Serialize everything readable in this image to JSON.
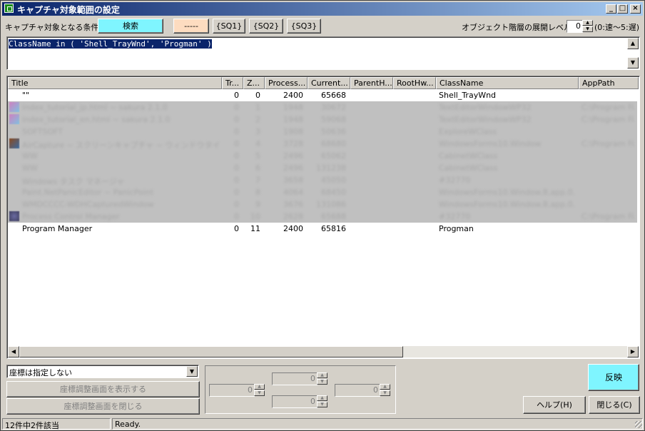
{
  "window": {
    "title": "キャプチャ対象範囲の設定",
    "controls": [
      "_",
      "□",
      "×"
    ]
  },
  "toolbar": {
    "condition_label": "キャプチャ対象となる条件:",
    "search_button": "検索",
    "dash_button": "-----",
    "sq1": "{SQ1}",
    "sq2": "{SQ2}",
    "sq3": "{SQ3}",
    "level_label": "オブジェクト階層の展開レベル:",
    "level_value": "0",
    "level_hint": "(0:速～5:遅)"
  },
  "query": {
    "text": "ClassName in ( 'Shell_TrayWnd', 'Progman' )"
  },
  "table": {
    "columns": [
      "Title",
      "Tr...",
      "Z...",
      "Process...",
      "Current...",
      "ParentH...",
      "RootHw...",
      "ClassName",
      "AppPath"
    ],
    "rows": [
      {
        "title": "\"\"",
        "tr": "0",
        "z": "0",
        "process": "2400",
        "current": "65668",
        "parent": "",
        "root": "",
        "classname": "Shell_TrayWnd",
        "apppath": "",
        "dim": false
      },
      {
        "title": "index_tutorial_jp.html ~ sakura 2.1.0",
        "tr": "0",
        "z": "1",
        "process": "1948",
        "current": "30672",
        "parent": "",
        "root": "",
        "classname": "TextEditorWindowWP32",
        "apppath": "C:\\Program Files\\sakura",
        "dim": true
      },
      {
        "title": "index_tutorial_en.html ~ sakura 2.1.0",
        "tr": "0",
        "z": "2",
        "process": "1948",
        "current": "59068",
        "parent": "",
        "root": "",
        "classname": "TextEditorWindowWP32",
        "apppath": "C:\\Program Files\\sakura",
        "dim": true
      },
      {
        "title": "SOFTSOFT",
        "tr": "0",
        "z": "3",
        "process": "1908",
        "current": "50636",
        "parent": "",
        "root": "",
        "classname": "ExploreWClass",
        "apppath": "",
        "dim": true
      },
      {
        "title": "AirCapture ~ スクリーンキャプチャ ~ ウィンドウタイトル",
        "tr": "0",
        "z": "4",
        "process": "3728",
        "current": "68680",
        "parent": "",
        "root": "",
        "classname": "WindowsForms10.Window",
        "apppath": "C:\\Program Files\\AirCap",
        "dim": true
      },
      {
        "title": "WW",
        "tr": "0",
        "z": "5",
        "process": "2496",
        "current": "65062",
        "parent": "",
        "root": "",
        "classname": "CabinetWClass",
        "apppath": "",
        "dim": true
      },
      {
        "title": "WW",
        "tr": "0",
        "z": "6",
        "process": "2496",
        "current": "131238",
        "parent": "",
        "root": "",
        "classname": "CabinetWClass",
        "apppath": "",
        "dim": true
      },
      {
        "title": "Windows タスク マネージャ",
        "tr": "0",
        "z": "7",
        "process": "3658",
        "current": "45050",
        "parent": "",
        "root": "",
        "classname": "#32770",
        "apppath": "",
        "dim": true
      },
      {
        "title": "Paint.NetPanicEditor ~ PanicPoint",
        "tr": "0",
        "z": "8",
        "process": "4064",
        "current": "68450",
        "parent": "",
        "root": "",
        "classname": "WindowsForms10.Window.8.app.0.2bf8",
        "apppath": "",
        "dim": true
      },
      {
        "title": "WMDCCCC-WDHCapturedWindow",
        "tr": "0",
        "z": "9",
        "process": "3676",
        "current": "131086",
        "parent": "",
        "root": "",
        "classname": "WindowsForms10.Window.8.app.0.33c0",
        "apppath": "",
        "dim": true
      },
      {
        "title": "Process Control Manager",
        "tr": "0",
        "z": "10",
        "process": "2628",
        "current": "65688",
        "parent": "",
        "root": "",
        "classname": "#32770",
        "apppath": "C:\\Program Files\\PCM",
        "dim": true
      },
      {
        "title": "Program Manager",
        "tr": "0",
        "z": "11",
        "process": "2400",
        "current": "65816",
        "parent": "",
        "root": "",
        "classname": "Progman",
        "apppath": "",
        "dim": false
      }
    ]
  },
  "bottom": {
    "coord_select": "座標は指定しない",
    "show_coord_button": "座標調整画面を表示する",
    "close_coord_button": "座標調整画面を閉じる",
    "spin_top": "0",
    "spin_left": "0",
    "spin_mid": "0",
    "spin_right": "0",
    "spin_bottom": "0",
    "apply_button": "反映",
    "help_button": "ヘルプ(H)",
    "close_button": "閉じる(C)"
  },
  "status": {
    "count": "12件中2件該当",
    "state": "Ready."
  }
}
